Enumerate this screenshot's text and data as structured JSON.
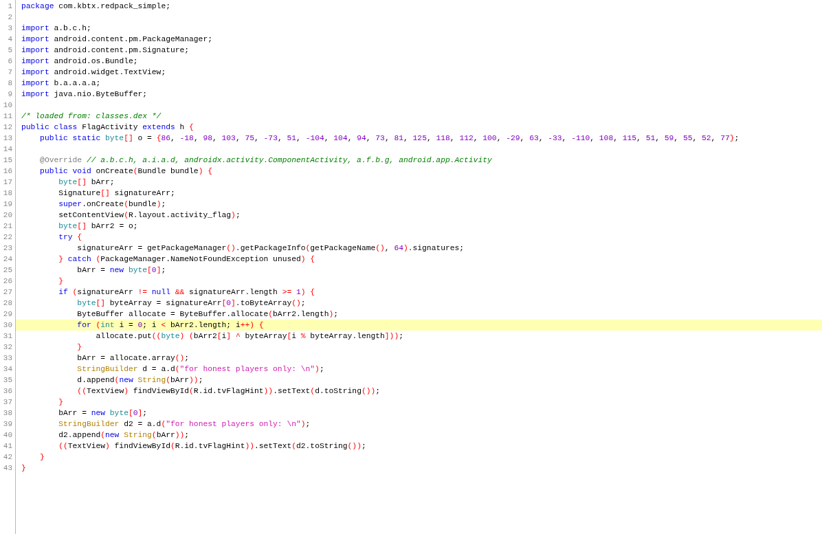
{
  "editor": {
    "lines": [
      {
        "number": "1",
        "highlighted": false,
        "tokens": [
          {
            "kind": "keyword",
            "text": "package"
          },
          {
            "kind": "plain",
            "text": " com.kbtx.redpack_simple;"
          }
        ]
      },
      {
        "number": "2",
        "highlighted": false
      },
      {
        "number": "3",
        "highlighted": false,
        "tokens": [
          {
            "kind": "keyword",
            "text": "import"
          },
          {
            "kind": "plain",
            "text": " a.b.c.h;"
          }
        ]
      },
      {
        "number": "4",
        "highlighted": false,
        "tokens": [
          {
            "kind": "keyword",
            "text": "import"
          },
          {
            "kind": "plain",
            "text": " android.content.pm.PackageManager;"
          }
        ]
      },
      {
        "number": "5",
        "highlighted": false,
        "tokens": [
          {
            "kind": "keyword",
            "text": "import"
          },
          {
            "kind": "plain",
            "text": " android.content.pm.Signature;"
          }
        ]
      },
      {
        "number": "6",
        "highlighted": false,
        "tokens": [
          {
            "kind": "keyword",
            "text": "import"
          },
          {
            "kind": "plain",
            "text": " android.os.Bundle;"
          }
        ]
      },
      {
        "number": "7",
        "highlighted": false,
        "tokens": [
          {
            "kind": "keyword",
            "text": "import"
          },
          {
            "kind": "plain",
            "text": " android.widget.TextView;"
          }
        ]
      },
      {
        "number": "8",
        "highlighted": false,
        "tokens": [
          {
            "kind": "keyword",
            "text": "import"
          },
          {
            "kind": "plain",
            "text": " b.a.a.a.a;"
          }
        ]
      },
      {
        "number": "9",
        "highlighted": false,
        "tokens": [
          {
            "kind": "keyword",
            "text": "import"
          },
          {
            "kind": "plain",
            "text": " java.nio.ByteBuffer;"
          }
        ]
      },
      {
        "number": "10",
        "highlighted": false
      },
      {
        "number": "11",
        "highlighted": false,
        "tokens": [
          {
            "kind": "comment",
            "text": "/* loaded from: classes.dex */"
          }
        ]
      },
      {
        "number": "12",
        "highlighted": false,
        "tokens": [
          {
            "kind": "keyword",
            "text": "public class"
          },
          {
            "kind": "plain",
            "text": " FlagActivity "
          },
          {
            "kind": "keyword",
            "text": "extends"
          },
          {
            "kind": "plain",
            "text": " h "
          },
          {
            "kind": "punct",
            "text": "{"
          }
        ]
      },
      {
        "number": "13",
        "highlighted": false,
        "tokens": [
          {
            "kind": "keyword",
            "text": "    public static"
          },
          {
            "kind": "type",
            "text": " byte"
          },
          {
            "kind": "punct",
            "text": "[]"
          },
          {
            "kind": "plain",
            "text": " o = "
          },
          {
            "kind": "punct",
            "text": "{"
          },
          {
            "kind": "number",
            "text": "86"
          },
          {
            "kind": "plain",
            "text": ", "
          },
          {
            "kind": "number",
            "text": "-18"
          },
          {
            "kind": "plain",
            "text": ", "
          },
          {
            "kind": "number",
            "text": "98"
          },
          {
            "kind": "plain",
            "text": ", "
          },
          {
            "kind": "number",
            "text": "103"
          },
          {
            "kind": "plain",
            "text": ", "
          },
          {
            "kind": "number",
            "text": "75"
          },
          {
            "kind": "plain",
            "text": ", "
          },
          {
            "kind": "number",
            "text": "-73"
          },
          {
            "kind": "plain",
            "text": ", "
          },
          {
            "kind": "number",
            "text": "51"
          },
          {
            "kind": "plain",
            "text": ", "
          },
          {
            "kind": "number",
            "text": "-104"
          },
          {
            "kind": "plain",
            "text": ", "
          },
          {
            "kind": "number",
            "text": "104"
          },
          {
            "kind": "plain",
            "text": ", "
          },
          {
            "kind": "number",
            "text": "94"
          },
          {
            "kind": "plain",
            "text": ", "
          },
          {
            "kind": "number",
            "text": "73"
          },
          {
            "kind": "plain",
            "text": ", "
          },
          {
            "kind": "number",
            "text": "81"
          },
          {
            "kind": "plain",
            "text": ", "
          },
          {
            "kind": "number",
            "text": "125"
          },
          {
            "kind": "plain",
            "text": ", "
          },
          {
            "kind": "number",
            "text": "118"
          },
          {
            "kind": "plain",
            "text": ", "
          },
          {
            "kind": "number",
            "text": "112"
          },
          {
            "kind": "plain",
            "text": ", "
          },
          {
            "kind": "number",
            "text": "100"
          },
          {
            "kind": "plain",
            "text": ", "
          },
          {
            "kind": "number",
            "text": "-29"
          },
          {
            "kind": "plain",
            "text": ", "
          },
          {
            "kind": "number",
            "text": "63"
          },
          {
            "kind": "plain",
            "text": ", "
          },
          {
            "kind": "number",
            "text": "-33"
          },
          {
            "kind": "plain",
            "text": ", "
          },
          {
            "kind": "number",
            "text": "-110"
          },
          {
            "kind": "plain",
            "text": ", "
          },
          {
            "kind": "number",
            "text": "108"
          },
          {
            "kind": "plain",
            "text": ", "
          },
          {
            "kind": "number",
            "text": "115"
          },
          {
            "kind": "plain",
            "text": ", "
          },
          {
            "kind": "number",
            "text": "51"
          },
          {
            "kind": "plain",
            "text": ", "
          },
          {
            "kind": "number",
            "text": "59"
          },
          {
            "kind": "plain",
            "text": ", "
          },
          {
            "kind": "number",
            "text": "55"
          },
          {
            "kind": "plain",
            "text": ", "
          },
          {
            "kind": "number",
            "text": "52"
          },
          {
            "kind": "plain",
            "text": ", "
          },
          {
            "kind": "number",
            "text": "77"
          },
          {
            "kind": "punct",
            "text": "}"
          },
          {
            "kind": "plain",
            "text": ";"
          }
        ]
      },
      {
        "number": "14",
        "highlighted": false
      },
      {
        "number": "15",
        "highlighted": false,
        "tokens": [
          {
            "kind": "annotation",
            "text": "    @Override"
          },
          {
            "kind": "comment",
            "text": " // a.b.c.h, a.i.a.d, androidx.activity.ComponentActivity, a.f.b.g, android.app.Activity"
          }
        ]
      },
      {
        "number": "16",
        "highlighted": false,
        "tokens": [
          {
            "kind": "keyword",
            "text": "    public void"
          },
          {
            "kind": "plain",
            "text": " onCreate"
          },
          {
            "kind": "punct",
            "text": "("
          },
          {
            "kind": "plain",
            "text": "Bundle bundle"
          },
          {
            "kind": "punct",
            "text": ")"
          },
          {
            "kind": "punct",
            "text": " {"
          }
        ]
      },
      {
        "number": "17",
        "highlighted": false,
        "tokens": [
          {
            "kind": "type",
            "text": "        byte"
          },
          {
            "kind": "punct",
            "text": "[]"
          },
          {
            "kind": "plain",
            "text": " bArr;"
          }
        ]
      },
      {
        "number": "18",
        "highlighted": false,
        "tokens": [
          {
            "kind": "plain",
            "text": "        Signature"
          },
          {
            "kind": "punct",
            "text": "[]"
          },
          {
            "kind": "plain",
            "text": " signatureArr;"
          }
        ]
      },
      {
        "number": "19",
        "highlighted": false,
        "tokens": [
          {
            "kind": "keyword",
            "text": "        super"
          },
          {
            "kind": "plain",
            "text": ".onCreate"
          },
          {
            "kind": "punct",
            "text": "("
          },
          {
            "kind": "plain",
            "text": "bundle"
          },
          {
            "kind": "punct",
            "text": ")"
          },
          {
            "kind": "plain",
            "text": ";"
          }
        ]
      },
      {
        "number": "20",
        "highlighted": false,
        "tokens": [
          {
            "kind": "plain",
            "text": "        setContentView"
          },
          {
            "kind": "punct",
            "text": "("
          },
          {
            "kind": "plain",
            "text": "R.layout.activity_flag"
          },
          {
            "kind": "punct",
            "text": ")"
          },
          {
            "kind": "plain",
            "text": ";"
          }
        ]
      },
      {
        "number": "21",
        "highlighted": false,
        "tokens": [
          {
            "kind": "type",
            "text": "        byte"
          },
          {
            "kind": "punct",
            "text": "[]"
          },
          {
            "kind": "plain",
            "text": " bArr2 = o;"
          }
        ]
      },
      {
        "number": "22",
        "highlighted": false,
        "tokens": [
          {
            "kind": "keyword",
            "text": "        try"
          },
          {
            "kind": "punct",
            "text": " {"
          }
        ]
      },
      {
        "number": "23",
        "highlighted": false,
        "tokens": [
          {
            "kind": "plain",
            "text": "            signatureArr = getPackageManager"
          },
          {
            "kind": "punct",
            "text": "()"
          },
          {
            "kind": "plain",
            "text": ".getPackageInfo"
          },
          {
            "kind": "punct",
            "text": "("
          },
          {
            "kind": "plain",
            "text": "getPackageName"
          },
          {
            "kind": "punct",
            "text": "()"
          },
          {
            "kind": "plain",
            "text": ", "
          },
          {
            "kind": "number",
            "text": "64"
          },
          {
            "kind": "punct",
            "text": ")"
          },
          {
            "kind": "plain",
            "text": ".signatures;"
          }
        ]
      },
      {
        "number": "24",
        "highlighted": false,
        "tokens": [
          {
            "kind": "punct",
            "text": "        }"
          },
          {
            "kind": "keyword",
            "text": " catch"
          },
          {
            "kind": "punct",
            "text": " ("
          },
          {
            "kind": "plain",
            "text": "PackageManager.NameNotFoundException unused"
          },
          {
            "kind": "punct",
            "text": ")"
          },
          {
            "kind": "punct",
            "text": " {"
          }
        ]
      },
      {
        "number": "25",
        "highlighted": false,
        "tokens": [
          {
            "kind": "plain",
            "text": "            bArr = "
          },
          {
            "kind": "keyword",
            "text": "new"
          },
          {
            "kind": "type",
            "text": " byte"
          },
          {
            "kind": "punct",
            "text": "["
          },
          {
            "kind": "number",
            "text": "0"
          },
          {
            "kind": "punct",
            "text": "]"
          },
          {
            "kind": "plain",
            "text": ";"
          }
        ]
      },
      {
        "number": "26",
        "highlighted": false,
        "tokens": [
          {
            "kind": "punct",
            "text": "        }"
          }
        ]
      },
      {
        "number": "27",
        "highlighted": false,
        "tokens": [
          {
            "kind": "keyword",
            "text": "        if"
          },
          {
            "kind": "punct",
            "text": " ("
          },
          {
            "kind": "plain",
            "text": "signatureArr "
          },
          {
            "kind": "punct",
            "text": "!="
          },
          {
            "kind": "keyword",
            "text": " null"
          },
          {
            "kind": "punct",
            "text": " &&"
          },
          {
            "kind": "plain",
            "text": " signatureArr.length "
          },
          {
            "kind": "punct",
            "text": ">="
          },
          {
            "kind": "number",
            "text": " 1"
          },
          {
            "kind": "punct",
            "text": ")"
          },
          {
            "kind": "punct",
            "text": " {"
          }
        ]
      },
      {
        "number": "28",
        "highlighted": false,
        "tokens": [
          {
            "kind": "type",
            "text": "            byte"
          },
          {
            "kind": "punct",
            "text": "[]"
          },
          {
            "kind": "plain",
            "text": " byteArray = signatureArr"
          },
          {
            "kind": "punct",
            "text": "["
          },
          {
            "kind": "number",
            "text": "0"
          },
          {
            "kind": "punct",
            "text": "]"
          },
          {
            "kind": "plain",
            "text": ".toByteArray"
          },
          {
            "kind": "punct",
            "text": "()"
          },
          {
            "kind": "plain",
            "text": ";"
          }
        ]
      },
      {
        "number": "29",
        "highlighted": false,
        "tokens": [
          {
            "kind": "plain",
            "text": "            ByteBuffer allocate = ByteBuffer.allocate"
          },
          {
            "kind": "punct",
            "text": "("
          },
          {
            "kind": "plain",
            "text": "bArr2.length"
          },
          {
            "kind": "punct",
            "text": ")"
          },
          {
            "kind": "plain",
            "text": ";"
          }
        ]
      },
      {
        "number": "30",
        "highlighted": true,
        "tokens": [
          {
            "kind": "keyword",
            "text": "            for"
          },
          {
            "kind": "punct",
            "text": " ("
          },
          {
            "kind": "type",
            "text": "int"
          },
          {
            "kind": "plain",
            "text": " i = "
          },
          {
            "kind": "number",
            "text": "0"
          },
          {
            "kind": "plain",
            "text": "; i "
          },
          {
            "kind": "punct",
            "text": "<"
          },
          {
            "kind": "plain",
            "text": " bArr2.length; i"
          },
          {
            "kind": "punct",
            "text": "++)"
          },
          {
            "kind": "punct",
            "text": " {"
          }
        ]
      },
      {
        "number": "31",
        "highlighted": false,
        "tokens": [
          {
            "kind": "plain",
            "text": "                allocate.put"
          },
          {
            "kind": "punct",
            "text": "(("
          },
          {
            "kind": "type",
            "text": "byte"
          },
          {
            "kind": "punct",
            "text": ")"
          },
          {
            "kind": "punct",
            "text": " ("
          },
          {
            "kind": "plain",
            "text": "bArr2"
          },
          {
            "kind": "punct",
            "text": "["
          },
          {
            "kind": "plain",
            "text": "i"
          },
          {
            "kind": "punct",
            "text": "]"
          },
          {
            "kind": "punct",
            "text": " ^"
          },
          {
            "kind": "plain",
            "text": " byteArray"
          },
          {
            "kind": "punct",
            "text": "["
          },
          {
            "kind": "plain",
            "text": "i "
          },
          {
            "kind": "punct",
            "text": "%"
          },
          {
            "kind": "plain",
            "text": " byteArray.length"
          },
          {
            "kind": "punct",
            "text": "]))"
          },
          {
            "kind": "plain",
            "text": ";"
          }
        ]
      },
      {
        "number": "32",
        "highlighted": false,
        "tokens": [
          {
            "kind": "punct",
            "text": "            }"
          }
        ]
      },
      {
        "number": "33",
        "highlighted": false,
        "tokens": [
          {
            "kind": "plain",
            "text": "            bArr = allocate.array"
          },
          {
            "kind": "punct",
            "text": "()"
          },
          {
            "kind": "plain",
            "text": ";"
          }
        ]
      },
      {
        "number": "34",
        "highlighted": false,
        "tokens": [
          {
            "kind": "class",
            "text": "            StringBuilder"
          },
          {
            "kind": "plain",
            "text": " d = a.d"
          },
          {
            "kind": "punct",
            "text": "("
          },
          {
            "kind": "string",
            "text": "\"for honest players only: \\n\""
          },
          {
            "kind": "punct",
            "text": ")"
          },
          {
            "kind": "plain",
            "text": ";"
          }
        ]
      },
      {
        "number": "35",
        "highlighted": false,
        "tokens": [
          {
            "kind": "plain",
            "text": "            d.append"
          },
          {
            "kind": "punct",
            "text": "("
          },
          {
            "kind": "keyword",
            "text": "new"
          },
          {
            "kind": "class",
            "text": " String"
          },
          {
            "kind": "punct",
            "text": "("
          },
          {
            "kind": "plain",
            "text": "bArr"
          },
          {
            "kind": "punct",
            "text": "))"
          },
          {
            "kind": "plain",
            "text": ";"
          }
        ]
      },
      {
        "number": "36",
        "highlighted": false,
        "tokens": [
          {
            "kind": "punct",
            "text": "            (("
          },
          {
            "kind": "plain",
            "text": "TextView"
          },
          {
            "kind": "punct",
            "text": ")"
          },
          {
            "kind": "plain",
            "text": " findViewById"
          },
          {
            "kind": "punct",
            "text": "("
          },
          {
            "kind": "plain",
            "text": "R.id.tvFlagHint"
          },
          {
            "kind": "punct",
            "text": "))"
          },
          {
            "kind": "plain",
            "text": ".setText"
          },
          {
            "kind": "punct",
            "text": "("
          },
          {
            "kind": "plain",
            "text": "d.toString"
          },
          {
            "kind": "punct",
            "text": "())"
          },
          {
            "kind": "plain",
            "text": ";"
          }
        ]
      },
      {
        "number": "37",
        "highlighted": false,
        "tokens": [
          {
            "kind": "punct",
            "text": "        }"
          }
        ]
      },
      {
        "number": "38",
        "highlighted": false,
        "tokens": [
          {
            "kind": "plain",
            "text": "        bArr = "
          },
          {
            "kind": "keyword",
            "text": "new"
          },
          {
            "kind": "type",
            "text": " byte"
          },
          {
            "kind": "punct",
            "text": "["
          },
          {
            "kind": "number",
            "text": "0"
          },
          {
            "kind": "punct",
            "text": "]"
          },
          {
            "kind": "plain",
            "text": ";"
          }
        ]
      },
      {
        "number": "39",
        "highlighted": false,
        "tokens": [
          {
            "kind": "class",
            "text": "        StringBuilder"
          },
          {
            "kind": "plain",
            "text": " d2 = a.d"
          },
          {
            "kind": "punct",
            "text": "("
          },
          {
            "kind": "string",
            "text": "\"for honest players only: \\n\""
          },
          {
            "kind": "punct",
            "text": ")"
          },
          {
            "kind": "plain",
            "text": ";"
          }
        ]
      },
      {
        "number": "40",
        "highlighted": false,
        "tokens": [
          {
            "kind": "plain",
            "text": "        d2.append"
          },
          {
            "kind": "punct",
            "text": "("
          },
          {
            "kind": "keyword",
            "text": "new"
          },
          {
            "kind": "class",
            "text": " String"
          },
          {
            "kind": "punct",
            "text": "("
          },
          {
            "kind": "plain",
            "text": "bArr"
          },
          {
            "kind": "punct",
            "text": "))"
          },
          {
            "kind": "plain",
            "text": ";"
          }
        ]
      },
      {
        "number": "41",
        "highlighted": false,
        "tokens": [
          {
            "kind": "punct",
            "text": "        (("
          },
          {
            "kind": "plain",
            "text": "TextView"
          },
          {
            "kind": "punct",
            "text": ")"
          },
          {
            "kind": "plain",
            "text": " findViewById"
          },
          {
            "kind": "punct",
            "text": "("
          },
          {
            "kind": "plain",
            "text": "R.id.tvFlagHint"
          },
          {
            "kind": "punct",
            "text": "))"
          },
          {
            "kind": "plain",
            "text": ".setText"
          },
          {
            "kind": "punct",
            "text": "("
          },
          {
            "kind": "plain",
            "text": "d2.toString"
          },
          {
            "kind": "punct",
            "text": "())"
          },
          {
            "kind": "plain",
            "text": ";"
          }
        ]
      },
      {
        "number": "42",
        "highlighted": false,
        "tokens": [
          {
            "kind": "punct",
            "text": "    }"
          }
        ]
      },
      {
        "number": "43",
        "highlighted": false,
        "tokens": [
          {
            "kind": "punct",
            "text": "}"
          }
        ]
      }
    ]
  }
}
